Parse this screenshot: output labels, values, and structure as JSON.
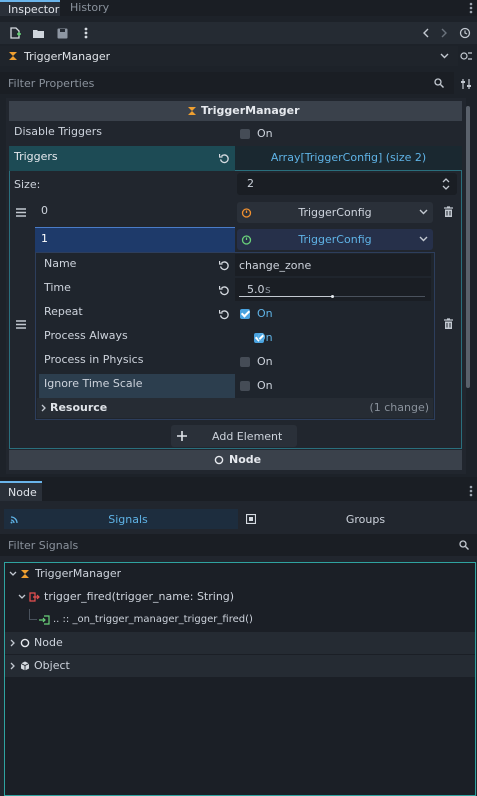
{
  "tabs": {
    "inspector": "Inspector",
    "history": "History"
  },
  "object_bar": {
    "name": "TriggerManager"
  },
  "filter_props": {
    "placeholder": "Filter Properties"
  },
  "section": {
    "title": "TriggerManager"
  },
  "disable_triggers": {
    "label": "Disable Triggers",
    "value": "On"
  },
  "triggers": {
    "label": "Triggers",
    "type": "Array[TriggerConfig] (size 2)",
    "size_label": "Size:",
    "size_value": "2",
    "items": [
      {
        "index": "0",
        "type": "TriggerConfig"
      },
      {
        "index": "1",
        "type": "TriggerConfig"
      }
    ]
  },
  "trigger_config": {
    "name_label": "Name",
    "name_value": "change_zone",
    "time_label": "Time",
    "time_value": "5.0",
    "time_unit": "s",
    "time_slider_fraction": 0.5,
    "repeat_label": "Repeat",
    "repeat_value": "On",
    "process_always_label": "Process Always",
    "process_always_value": "On",
    "process_physics_label": "Process in Physics",
    "process_physics_value": "On",
    "ignore_time_label": "Ignore Time Scale",
    "ignore_time_value": "On",
    "resource_label": "Resource",
    "resource_changes": "(1 change)"
  },
  "add_element": "Add Element",
  "node_section": "Node",
  "node_dock": {
    "tab": "Node",
    "signals_tab": "Signals",
    "groups_tab": "Groups",
    "filter_placeholder": "Filter Signals",
    "tree": {
      "root": "TriggerManager",
      "signal": "trigger_fired(trigger_name: String)",
      "connection": ".. :: _on_trigger_manager_trigger_fired()",
      "node": "Node",
      "object": "Object"
    }
  },
  "colors": {
    "accent": "#5fb3e6",
    "teal": "#1d4b55",
    "selected": "#1e3a6a"
  }
}
